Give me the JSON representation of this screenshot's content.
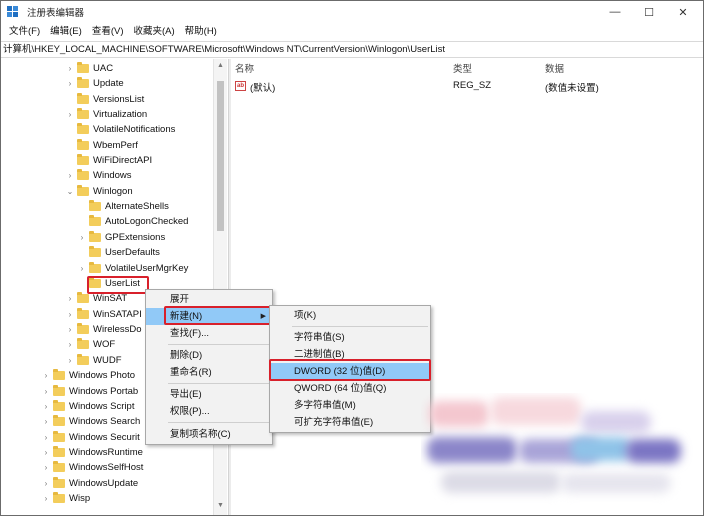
{
  "window": {
    "title": "注册表编辑器",
    "controls": {
      "minimize": "—",
      "maximize": "☐",
      "close": "✕"
    }
  },
  "menubar": [
    {
      "label": "文件(F)"
    },
    {
      "label": "编辑(E)"
    },
    {
      "label": "查看(V)"
    },
    {
      "label": "收藏夹(A)"
    },
    {
      "label": "帮助(H)"
    }
  ],
  "address": "计算机\\HKEY_LOCAL_MACHINE\\SOFTWARE\\Microsoft\\Windows NT\\CurrentVersion\\Winlogon\\UserList",
  "tree": [
    {
      "label": "UAC",
      "expander": "›"
    },
    {
      "label": "Update",
      "expander": "›"
    },
    {
      "label": "VersionsList",
      "expander": ""
    },
    {
      "label": "Virtualization",
      "expander": "›"
    },
    {
      "label": "VolatileNotifications",
      "expander": ""
    },
    {
      "label": "WbemPerf",
      "expander": ""
    },
    {
      "label": "WiFiDirectAPI",
      "expander": ""
    },
    {
      "label": "Windows",
      "expander": "›"
    },
    {
      "label": "Winlogon",
      "expander": "⌄"
    },
    {
      "label": "AlternateShells",
      "expander": ""
    },
    {
      "label": "AutoLogonChecked",
      "expander": ""
    },
    {
      "label": "GPExtensions",
      "expander": "›"
    },
    {
      "label": "UserDefaults",
      "expander": ""
    },
    {
      "label": "VolatileUserMgrKey",
      "expander": "›"
    },
    {
      "label": "UserList",
      "expander": ""
    },
    {
      "label": "WinSAT",
      "expander": "›"
    },
    {
      "label": "WinSATAPI",
      "expander": "›"
    },
    {
      "label": "WirelessDo",
      "expander": "›"
    },
    {
      "label": "WOF",
      "expander": "›"
    },
    {
      "label": "WUDF",
      "expander": "›"
    },
    {
      "label": "Windows Photo",
      "expander": "›"
    },
    {
      "label": "Windows Portab",
      "expander": "›"
    },
    {
      "label": "Windows Script",
      "expander": "›"
    },
    {
      "label": "Windows Search",
      "expander": "›"
    },
    {
      "label": "Windows Securit",
      "expander": "›"
    },
    {
      "label": "WindowsRuntime",
      "expander": "›"
    },
    {
      "label": "WindowsSelfHost",
      "expander": "›"
    },
    {
      "label": "WindowsUpdate",
      "expander": "›"
    },
    {
      "label": "Wisp",
      "expander": "›"
    }
  ],
  "list": {
    "headers": {
      "name": "名称",
      "type": "类型",
      "data": "数据"
    },
    "rows": [
      {
        "name": "(默认)",
        "type": "REG_SZ",
        "data": "(数值未设置)"
      }
    ]
  },
  "context_menu": {
    "items": [
      "展开",
      "新建(N)",
      "查找(F)...",
      "删除(D)",
      "重命名(R)",
      "导出(E)",
      "权限(P)...",
      "复制项名称(C)"
    ],
    "submenu_arrow": "▶"
  },
  "submenu": {
    "items": [
      "项(K)",
      "字符串值(S)",
      "二进制值(B)",
      "DWORD (32 位)值(D)",
      "QWORD (64 位)值(Q)",
      "多字符串值(M)",
      "可扩充字符串值(E)"
    ]
  },
  "colors": {
    "highlight": "#91c9f7",
    "annotation_red": "#d8202b",
    "folder": "#f3cd5b",
    "titlebar_icon": "#1f6fc2"
  }
}
